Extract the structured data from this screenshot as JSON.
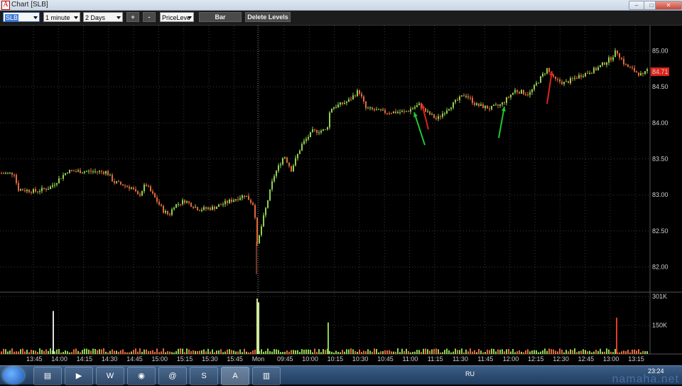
{
  "window": {
    "title": "Chart [SLB]",
    "app_icon_glyph": "A",
    "controls": {
      "minimize": "–",
      "maximize": "□",
      "close": "✕"
    }
  },
  "toolbar": {
    "symbol": "SLB",
    "interval": "1 minute",
    "range": "2 Days",
    "zoom_in": "+",
    "zoom_out": "-",
    "study": "PriceLeve",
    "bar_button": "Bar",
    "delete_levels_button": "Delete Levels"
  },
  "chart_data": {
    "type": "candlestick",
    "symbol": "SLB",
    "last_price": "84.71",
    "price_ticks": [
      "85.00",
      "84.50",
      "84.00",
      "83.50",
      "83.00",
      "82.50",
      "82.00"
    ],
    "price_range": [
      81.65,
      85.35
    ],
    "volume_ticks": [
      "301K",
      "150K"
    ],
    "volume_range": [
      0,
      301
    ],
    "time_labels": [
      "13:45",
      "14:00",
      "14:15",
      "14:30",
      "14:45",
      "15:00",
      "15:15",
      "15:30",
      "15:45",
      "Mon",
      "09:45",
      "10:00",
      "10:15",
      "10:30",
      "10:45",
      "11:00",
      "11:15",
      "11:30",
      "11:45",
      "12:00",
      "12:15",
      "12:30",
      "12:45",
      "13:00",
      "13:15"
    ],
    "price_path": [
      [
        0,
        83.3
      ],
      [
        20,
        83.3
      ],
      [
        25,
        83.08
      ],
      [
        50,
        83.05
      ],
      [
        70,
        83.1
      ],
      [
        95,
        83.33
      ],
      [
        150,
        83.32
      ],
      [
        160,
        83.18
      ],
      [
        185,
        83.1
      ],
      [
        195,
        82.98
      ],
      [
        205,
        83.15
      ],
      [
        230,
        82.78
      ],
      [
        238,
        82.72
      ],
      [
        245,
        82.85
      ],
      [
        260,
        82.92
      ],
      [
        280,
        82.8
      ],
      [
        300,
        82.82
      ],
      [
        345,
        83.0
      ],
      [
        358,
        82.85
      ],
      [
        362,
        82.3
      ],
      [
        370,
        82.65
      ],
      [
        385,
        83.25
      ],
      [
        400,
        83.55
      ],
      [
        410,
        83.35
      ],
      [
        425,
        83.7
      ],
      [
        440,
        83.88
      ],
      [
        460,
        83.9
      ],
      [
        465,
        84.2
      ],
      [
        490,
        84.3
      ],
      [
        505,
        84.45
      ],
      [
        515,
        84.2
      ],
      [
        540,
        84.15
      ],
      [
        570,
        84.15
      ],
      [
        590,
        84.25
      ],
      [
        600,
        84.15
      ],
      [
        615,
        84.05
      ],
      [
        630,
        84.2
      ],
      [
        655,
        84.4
      ],
      [
        670,
        84.25
      ],
      [
        690,
        84.2
      ],
      [
        705,
        84.25
      ],
      [
        725,
        84.45
      ],
      [
        745,
        84.4
      ],
      [
        770,
        84.75
      ],
      [
        780,
        84.6
      ],
      [
        795,
        84.55
      ],
      [
        815,
        84.65
      ],
      [
        840,
        84.75
      ],
      [
        860,
        84.9
      ],
      [
        868,
        85.0
      ],
      [
        880,
        84.8
      ],
      [
        905,
        84.65
      ],
      [
        912,
        84.75
      ]
    ],
    "volume_spikes": [
      {
        "time_index": 75,
        "value": 225,
        "color": "#e0e0e0"
      },
      {
        "time_index": 362,
        "value": 290,
        "color": "#cfe89a"
      },
      {
        "time_index": 364,
        "value": 270,
        "color": "#cfe89a"
      },
      {
        "time_index": 462,
        "value": 165,
        "color": "#8fd14f"
      },
      {
        "time_index": 868,
        "value": 190,
        "color": "#e23b2b"
      }
    ],
    "annotations": [
      {
        "type": "arrow",
        "color": "#22c833",
        "direction": "up",
        "label": ""
      },
      {
        "type": "arrow",
        "color": "#e0231b",
        "direction": "up",
        "label": ""
      },
      {
        "type": "arrow",
        "color": "#22c833",
        "direction": "up",
        "label": ""
      },
      {
        "type": "arrow",
        "color": "#e0231b",
        "direction": "up",
        "label": ""
      }
    ],
    "colors": {
      "up": "#8fd14f",
      "down": "#e2693b",
      "grid": "#3a3a3a",
      "background": "#000000",
      "last_price_tag": "#e0231b"
    }
  },
  "taskbar": {
    "apps": [
      {
        "name": "explorer",
        "glyph": "▤"
      },
      {
        "name": "media",
        "glyph": "▶"
      },
      {
        "name": "word",
        "glyph": "W"
      },
      {
        "name": "chrome",
        "glyph": "◉"
      },
      {
        "name": "mail",
        "glyph": "@"
      },
      {
        "name": "skype",
        "glyph": "S"
      },
      {
        "name": "trading-app",
        "glyph": "A"
      },
      {
        "name": "document",
        "glyph": "▥"
      }
    ],
    "language": "RU",
    "clock": "23:24"
  },
  "watermark": "namaha.net"
}
